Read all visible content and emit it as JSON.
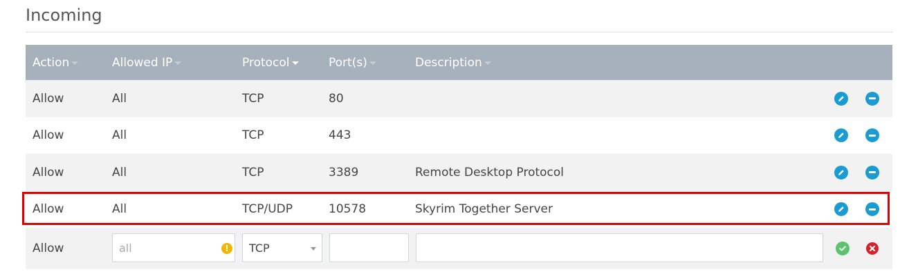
{
  "section": {
    "title": "Incoming"
  },
  "columns": {
    "action": "Action",
    "allowed_ip": "Allowed IP",
    "protocol": "Protocol",
    "ports": "Port(s)",
    "description": "Description"
  },
  "rules": [
    {
      "action": "Allow",
      "ip": "All",
      "protocol": "TCP",
      "port": "80",
      "description": ""
    },
    {
      "action": "Allow",
      "ip": "All",
      "protocol": "TCP",
      "port": "443",
      "description": ""
    },
    {
      "action": "Allow",
      "ip": "All",
      "protocol": "TCP",
      "port": "3389",
      "description": "Remote Desktop Protocol"
    },
    {
      "action": "Allow",
      "ip": "All",
      "protocol": "TCP/UDP",
      "port": "10578",
      "description": "Skyrim Together Server"
    }
  ],
  "new_rule": {
    "action": "Allow",
    "ip_placeholder": "all",
    "protocol_selected": "TCP",
    "port_value": "",
    "description_value": ""
  },
  "icons": {
    "edit": "pencil-icon",
    "remove": "minus-circle-icon",
    "save": "check-circle-icon",
    "cancel": "x-circle-icon",
    "warning": "exclamation-icon"
  },
  "colors": {
    "header_bg": "#a7b1bc",
    "accent_blue": "#1a9bd1",
    "save_green": "#5cc26b",
    "cancel_red": "#d9202a",
    "warning_yellow": "#f2b705",
    "highlight_red": "#e00000"
  }
}
